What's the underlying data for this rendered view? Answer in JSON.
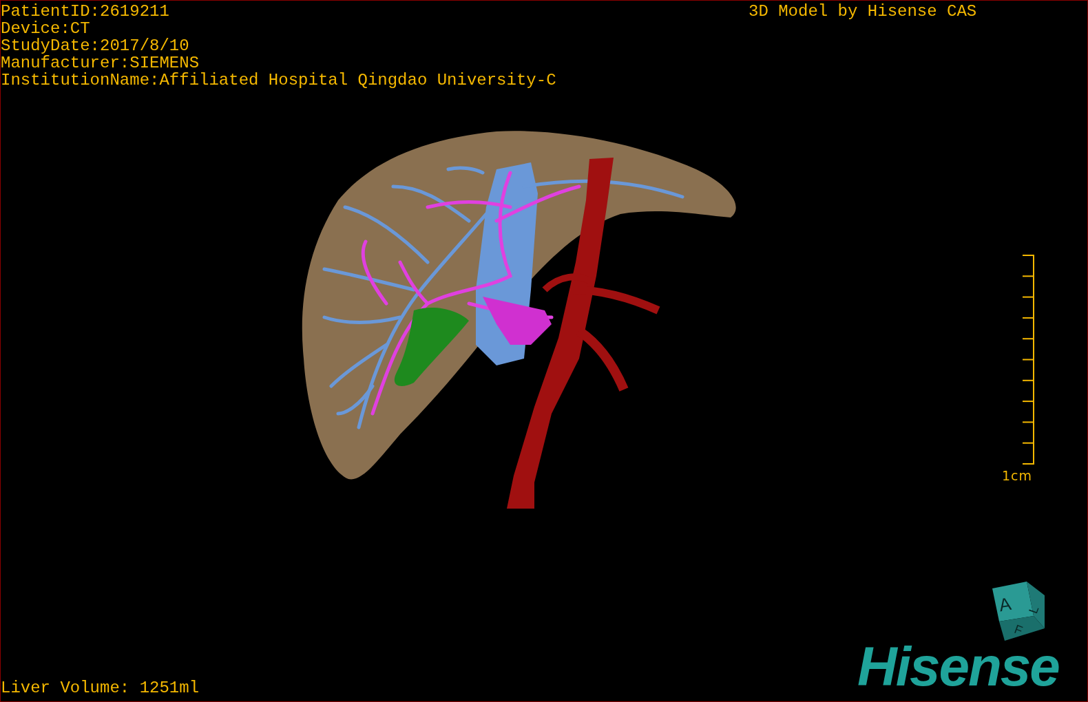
{
  "patient_info": [
    "PatientID:2619211",
    "Device:CT",
    "StudyDate:2017/8/10",
    "Manufacturer:SIEMENS",
    "InstitutionName:Affiliated Hospital Qingdao University-C"
  ],
  "credit": "3D Model by Hisense CAS",
  "measurement": "Liver Volume: 1251ml",
  "scale_bar": {
    "label": "1cm"
  },
  "orientation_cube": {
    "faces": [
      "A",
      "L",
      "F"
    ]
  },
  "logo": "Hisense"
}
